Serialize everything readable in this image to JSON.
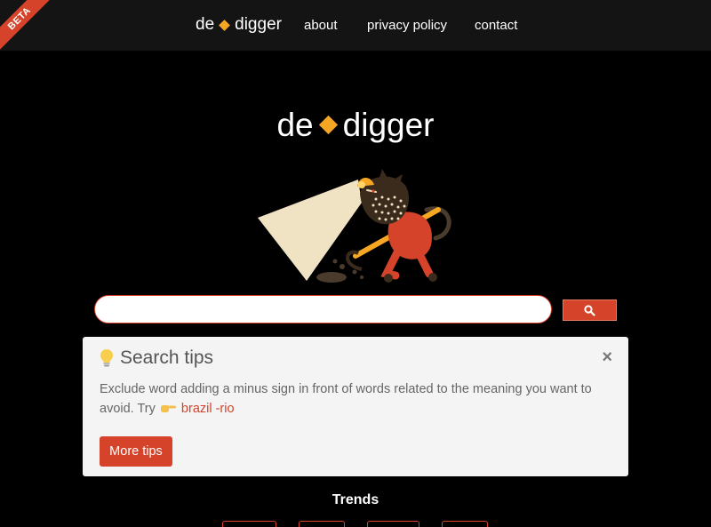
{
  "navbar": {
    "beta_label": "BETA",
    "brand_left": "de",
    "brand_right": "digger",
    "links": [
      {
        "label": "about"
      },
      {
        "label": "privacy policy"
      },
      {
        "label": "contact"
      }
    ]
  },
  "hero": {
    "logo_left": "de",
    "logo_right": "digger",
    "accent_color": "#f5a623"
  },
  "search": {
    "value": "",
    "placeholder": "",
    "button_icon": "search-icon",
    "brand_color": "#d4432a"
  },
  "tips": {
    "icon": "lightbulb-icon",
    "title": "Search tips",
    "close_label": "×",
    "body_text": "Exclude word adding a minus sign in front of words related to the meaning you want to avoid. Try",
    "pointer_icon": "pointing-hand-icon",
    "example": "brazil -rio",
    "more_button": "More tips"
  },
  "trends": {
    "heading": "Trends"
  }
}
